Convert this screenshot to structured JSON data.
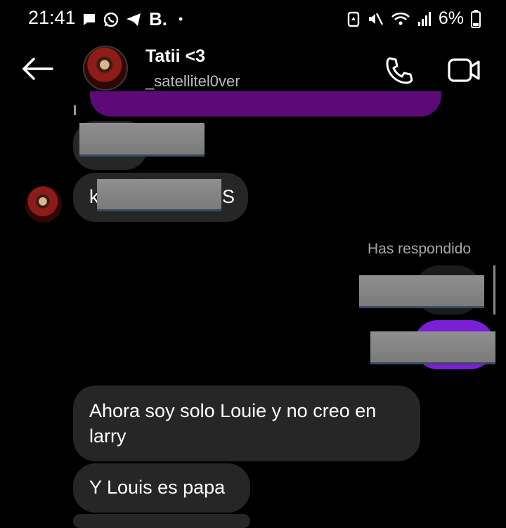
{
  "status_bar": {
    "time": "21:41",
    "left_icons": [
      "message-icon",
      "whatsapp-icon",
      "telegram-icon"
    ],
    "b_label": "B.",
    "dot": "•",
    "right_icons": [
      "battery-saver-icon",
      "mute-icon",
      "wifi-icon",
      "signal-icon"
    ],
    "battery_text": "6%"
  },
  "header": {
    "back_icon": "arrow-left-icon",
    "name": "Tatii <3",
    "handle": "_satellitel0ver",
    "call_icon": "phone-icon",
    "video_icon": "video-icon"
  },
  "messages": [
    {
      "side": "in",
      "text": "k",
      "text_end": "S",
      "redacted": true
    },
    {
      "label": "Has respondido"
    },
    {
      "side": "in",
      "text": "Ahora soy solo Louie y no creo en larry"
    },
    {
      "side": "in",
      "text": "Y Louis es papa"
    }
  ],
  "colors": {
    "incoming": "#262626",
    "outgoing": "#7a1fd6",
    "outgoing_dark": "#5c0a78",
    "background": "#000000"
  }
}
